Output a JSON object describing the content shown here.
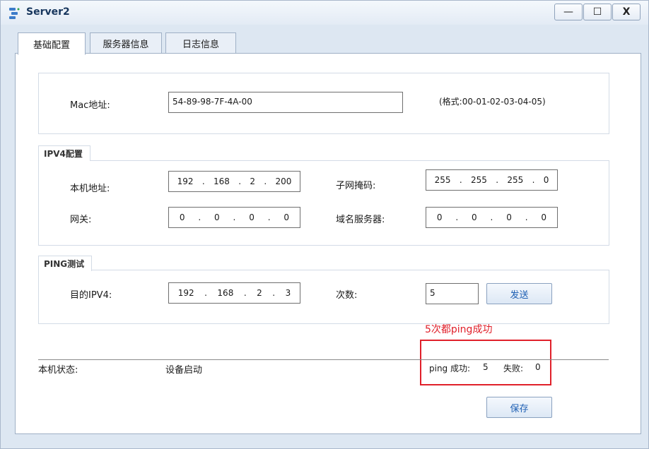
{
  "window": {
    "title": "Server2",
    "controls": {
      "minimize": "—",
      "maximize": "☐",
      "close": "X"
    }
  },
  "tabs": [
    {
      "label": "基础配置",
      "active": true
    },
    {
      "label": "服务器信息",
      "active": false
    },
    {
      "label": "日志信息",
      "active": false
    }
  ],
  "mac": {
    "label": "Mac地址:",
    "value": "54-89-98-7F-4A-00",
    "format_hint": "(格式:00-01-02-03-04-05)"
  },
  "ipv4": {
    "legend": "IPV4配置",
    "local_address": {
      "label": "本机地址:",
      "octets": [
        "192",
        "168",
        "2",
        "200"
      ]
    },
    "subnet_mask": {
      "label": "子网掩码:",
      "octets": [
        "255",
        "255",
        "255",
        "0"
      ]
    },
    "gateway": {
      "label": "网关:",
      "octets": [
        "0",
        "0",
        "0",
        "0"
      ]
    },
    "dns": {
      "label": "域名服务器:",
      "octets": [
        "0",
        "0",
        "0",
        "0"
      ]
    }
  },
  "ping": {
    "legend": "PING测试",
    "dest_label": "目的IPV4:",
    "dest_octets": [
      "192",
      "168",
      "2",
      "3"
    ],
    "count_label": "次数:",
    "count_value": "5",
    "send_button": "发送"
  },
  "status": {
    "label": "本机状态:",
    "value": "设备启动",
    "ping_success_label": "ping 成功:",
    "ping_success_value": "5",
    "fail_label": "失败:",
    "fail_value": "0"
  },
  "annotation": {
    "text": "5次都ping成功",
    "color": "#e0202a"
  },
  "save_button": "保存"
}
